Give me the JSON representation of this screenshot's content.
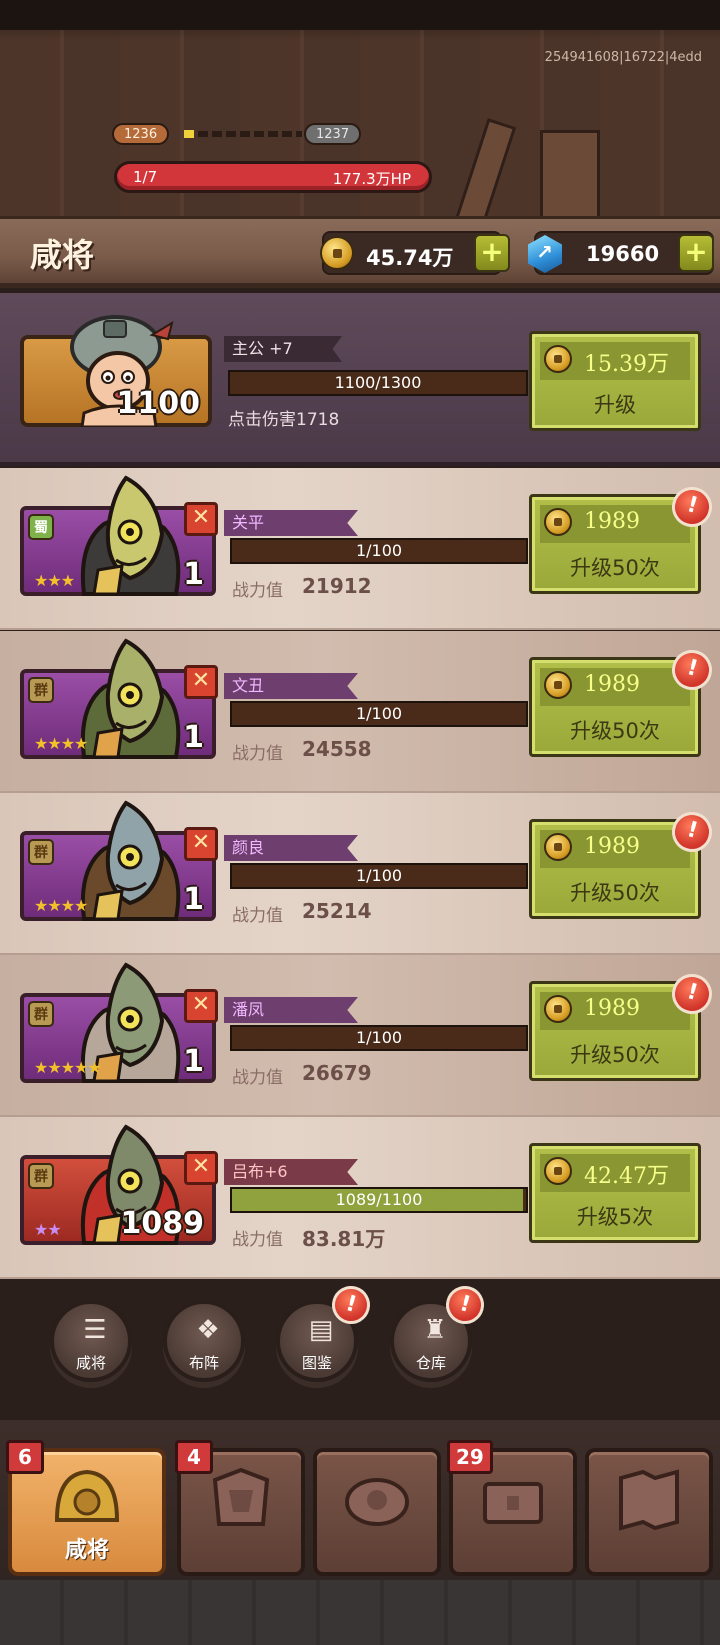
{
  "build_id": "254941608|16722|4edd",
  "stage": {
    "current": "1236",
    "next": "1237",
    "progress": 0.1
  },
  "boss_hp": {
    "wave": "1/7",
    "hp": "177.3万HP",
    "fraction": 1.0
  },
  "header": {
    "title": "咸将",
    "gold": "45.74万",
    "gems": "19660",
    "plus_symbol": "+"
  },
  "lord": {
    "name": "主公 +7",
    "level": "1100",
    "exp": "1100/1300",
    "exp_fraction": 0.0,
    "stat": "点击伤害1718",
    "cost": "15.39万",
    "action": "升级"
  },
  "heroes": [
    {
      "name": "关平",
      "faction": "蜀",
      "stars": "★★★",
      "level": "1",
      "exp": "1/100",
      "exp_fraction": 0.0,
      "power_label": "战力值",
      "power": "21912",
      "cost": "1989",
      "action": "升级50次",
      "alert": "!"
    },
    {
      "name": "文丑",
      "faction": "群",
      "stars": "★★★★",
      "level": "1",
      "exp": "1/100",
      "exp_fraction": 0.0,
      "power_label": "战力值",
      "power": "24558",
      "cost": "1989",
      "action": "升级50次",
      "alert": "!"
    },
    {
      "name": "颜良",
      "faction": "群",
      "stars": "★★★★",
      "level": "1",
      "exp": "1/100",
      "exp_fraction": 0.0,
      "power_label": "战力值",
      "power": "25214",
      "cost": "1989",
      "action": "升级50次",
      "alert": "!"
    },
    {
      "name": "潘凤",
      "faction": "群",
      "stars": "★★★★★",
      "level": "1",
      "exp": "1/100",
      "exp_fraction": 0.0,
      "power_label": "战力值",
      "power": "26679",
      "cost": "1989",
      "action": "升级50次",
      "alert": "!"
    },
    {
      "name": "吕布+6",
      "faction": "群",
      "stars": "★★",
      "level": "1089",
      "exp": "1089/1100",
      "exp_fraction": 0.99,
      "power_label": "战力值",
      "power": "83.81万",
      "cost": "42.47万",
      "action": "升级5次"
    }
  ],
  "round_menu": [
    {
      "label": "咸将",
      "icon": "list-icon"
    },
    {
      "label": "布阵",
      "icon": "formation-icon"
    },
    {
      "label": "图鉴",
      "icon": "book-icon",
      "alert": "!"
    },
    {
      "label": "仓库",
      "icon": "bag-icon",
      "alert": "!"
    }
  ],
  "tabs": [
    {
      "label": "咸将",
      "count": "6",
      "icon": "helmet-icon",
      "active": true
    },
    {
      "label": "",
      "count": "4",
      "icon": "armor-icon"
    },
    {
      "label": "",
      "count": "",
      "icon": "turtle-icon"
    },
    {
      "label": "",
      "count": "29",
      "icon": "chest-icon"
    },
    {
      "label": "",
      "count": "",
      "icon": "map-icon"
    }
  ],
  "colors": {
    "hp_red": "#d3363a",
    "button_green": "#9aa83a",
    "tab_active": "#d88a3e",
    "exp_green": "#8fa23d"
  }
}
